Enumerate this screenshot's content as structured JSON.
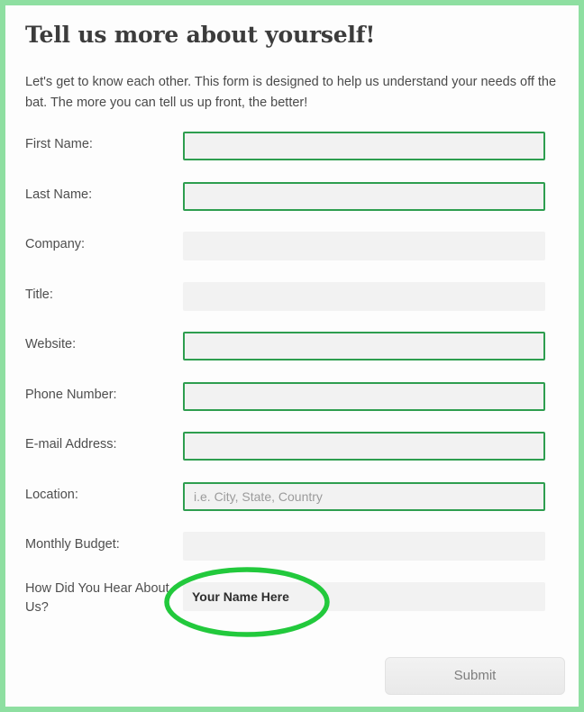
{
  "page": {
    "title": "Tell us more about yourself!",
    "intro": "Let's get to know each other. This form is designed to help us understand your needs off the bat. The more you can tell us up front, the better!"
  },
  "colors": {
    "page_border": "#8edfa1",
    "field_border_green": "#2e9e4f",
    "field_fill": "#f2f2f2",
    "annotation_green": "#22c93c",
    "label_text": "#4e4e4e",
    "placeholder_text": "#9b9b9b"
  },
  "form": {
    "fields": [
      {
        "label": "First Name:",
        "value": "",
        "placeholder": "",
        "style": "bordered"
      },
      {
        "label": "Last Name:",
        "value": "",
        "placeholder": "",
        "style": "bordered"
      },
      {
        "label": "Company:",
        "value": "",
        "placeholder": "",
        "style": "plain"
      },
      {
        "label": "Title:",
        "value": "",
        "placeholder": "",
        "style": "plain"
      },
      {
        "label": "Website:",
        "value": "",
        "placeholder": "",
        "style": "bordered"
      },
      {
        "label": "Phone Number:",
        "value": "",
        "placeholder": "",
        "style": "bordered"
      },
      {
        "label": "E-mail Address:",
        "value": "",
        "placeholder": "",
        "style": "bordered"
      },
      {
        "label": "Location:",
        "value": "",
        "placeholder": "i.e. City, State, Country",
        "style": "bordered"
      },
      {
        "label": "Monthly Budget:",
        "value": "",
        "placeholder": "",
        "style": "plain"
      },
      {
        "label": "How Did You Hear About Us?",
        "value": "Your Name Here",
        "placeholder": "",
        "style": "plain"
      }
    ],
    "submit_label": "Submit"
  },
  "annotation": {
    "shape": "ellipse",
    "target_field_label": "How Did You Hear About Us?",
    "target_value": "Your Name Here"
  }
}
